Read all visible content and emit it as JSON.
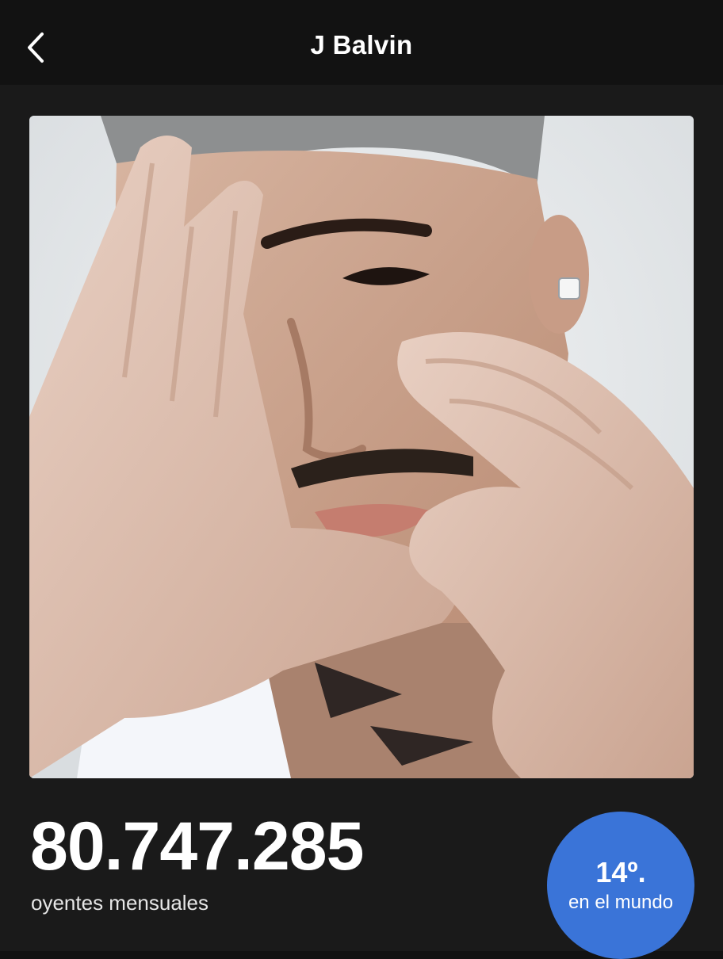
{
  "header": {
    "title": "J Balvin",
    "back_icon": "chevron-left-icon"
  },
  "artist_image": {
    "alt": "J Balvin"
  },
  "stats": {
    "monthly_listeners": "80.747.285",
    "monthly_listeners_label": "oyentes mensuales",
    "rank_number": "14º.",
    "rank_label": "en el mundo"
  },
  "colors": {
    "background": "#121212",
    "content_background": "#1a1a1a",
    "rank_badge": "#3a74d8",
    "text": "#ffffff"
  }
}
